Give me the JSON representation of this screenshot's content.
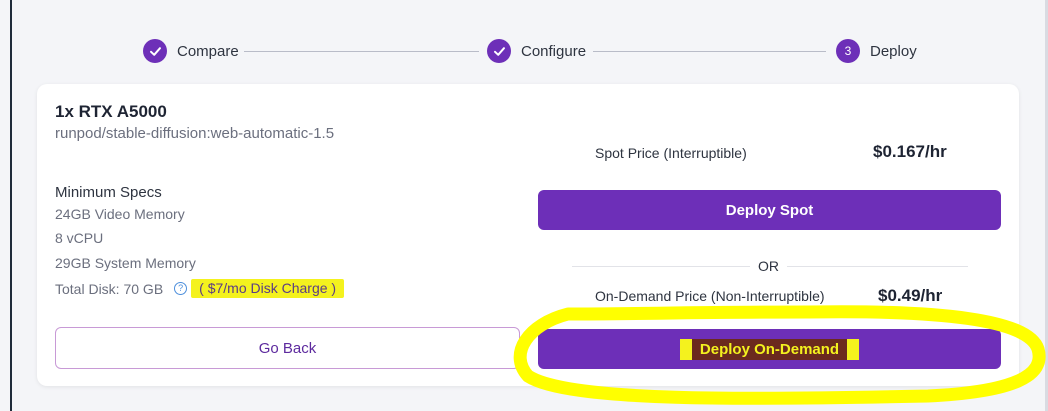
{
  "stepper": {
    "steps": [
      {
        "label": "Compare",
        "state": "done"
      },
      {
        "label": "Configure",
        "state": "done"
      },
      {
        "label": "Deploy",
        "state": "current",
        "number": "3"
      }
    ]
  },
  "card": {
    "title": "1x RTX A5000",
    "subtitle": "runpod/stable-diffusion:web-automatic-1.5",
    "specs_title": "Minimum Specs",
    "specs": [
      "24GB Video Memory",
      "8 vCPU",
      "29GB System Memory"
    ],
    "disk": {
      "label": "Total Disk: 70 GB",
      "help_icon": "question-icon",
      "charge": "( $7/mo Disk Charge )"
    },
    "go_back_label": "Go Back"
  },
  "pricing": {
    "spot": {
      "label": "Spot Price (Interruptible)",
      "value": "$0.167/hr",
      "button": "Deploy Spot"
    },
    "or_label": "OR",
    "on_demand": {
      "label": "On-Demand Price (Non-Interruptible)",
      "value": "$0.49/hr",
      "button": "Deploy On-Demand"
    }
  },
  "colors": {
    "accent": "#6d2fb8",
    "highlight": "#f4f21e",
    "annotation": "#ffff00"
  }
}
